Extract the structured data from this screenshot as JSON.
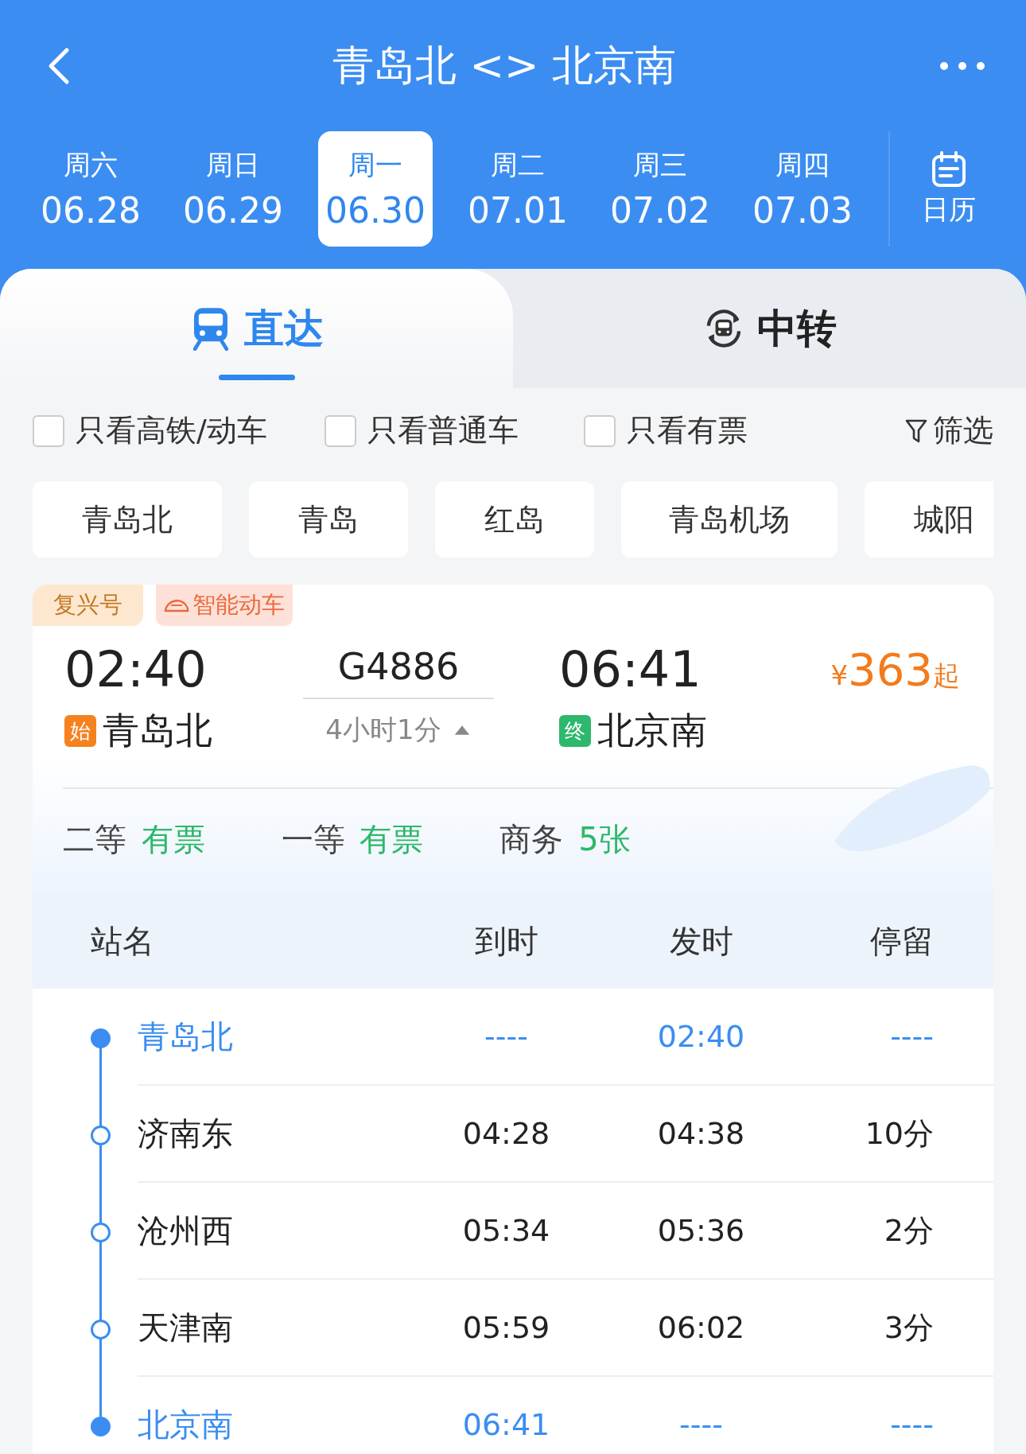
{
  "header": {
    "title": "青岛北 <> 北京南"
  },
  "dates": [
    {
      "weekday": "周六",
      "date": "06.28",
      "selected": false
    },
    {
      "weekday": "周日",
      "date": "06.29",
      "selected": false
    },
    {
      "weekday": "周一",
      "date": "06.30",
      "selected": true
    },
    {
      "weekday": "周二",
      "date": "07.01",
      "selected": false
    },
    {
      "weekday": "周三",
      "date": "07.02",
      "selected": false
    },
    {
      "weekday": "周四",
      "date": "07.03",
      "selected": false
    }
  ],
  "calendar": {
    "label": "日历"
  },
  "modes": [
    {
      "label": "直达",
      "kind": "direct",
      "selected": true
    },
    {
      "label": "中转",
      "kind": "transfer",
      "selected": false
    }
  ],
  "filters": [
    {
      "label": "只看高铁/动车",
      "checked": false
    },
    {
      "label": "只看普通车",
      "checked": false
    },
    {
      "label": "只看有票",
      "checked": false
    }
  ],
  "filter_button": {
    "label": "筛选"
  },
  "stations": [
    "青岛北",
    "青岛",
    "红岛",
    "青岛机场",
    "城阳"
  ],
  "train": {
    "tags": [
      {
        "label": "复兴号",
        "kind": "plain"
      },
      {
        "label": "智能动车",
        "kind": "smart"
      }
    ],
    "depart_time": "02:40",
    "origin_badge": "始",
    "origin": "青岛北",
    "number": "G4886",
    "duration": "4小时1分",
    "expanded": true,
    "arrive_time": "06:41",
    "dest_badge": "终",
    "destination": "北京南",
    "price_symbol": "¥",
    "price": "363",
    "price_suffix": "起",
    "seats": [
      {
        "class": "二等",
        "availability": "有票"
      },
      {
        "class": "一等",
        "availability": "有票"
      },
      {
        "class": "商务",
        "availability": "5张"
      }
    ]
  },
  "stops": {
    "columns": [
      "站名",
      "到时",
      "发时",
      "停留"
    ],
    "rows": [
      {
        "station": "青岛北",
        "arrive": "----",
        "depart": "02:40",
        "stay": "----",
        "highlight": true
      },
      {
        "station": "济南东",
        "arrive": "04:28",
        "depart": "04:38",
        "stay": "10分",
        "highlight": false
      },
      {
        "station": "沧州西",
        "arrive": "05:34",
        "depart": "05:36",
        "stay": "2分",
        "highlight": false
      },
      {
        "station": "天津南",
        "arrive": "05:59",
        "depart": "06:02",
        "stay": "3分",
        "highlight": false
      },
      {
        "station": "北京南",
        "arrive": "06:41",
        "depart": "----",
        "stay": "----",
        "highlight": true
      }
    ]
  }
}
